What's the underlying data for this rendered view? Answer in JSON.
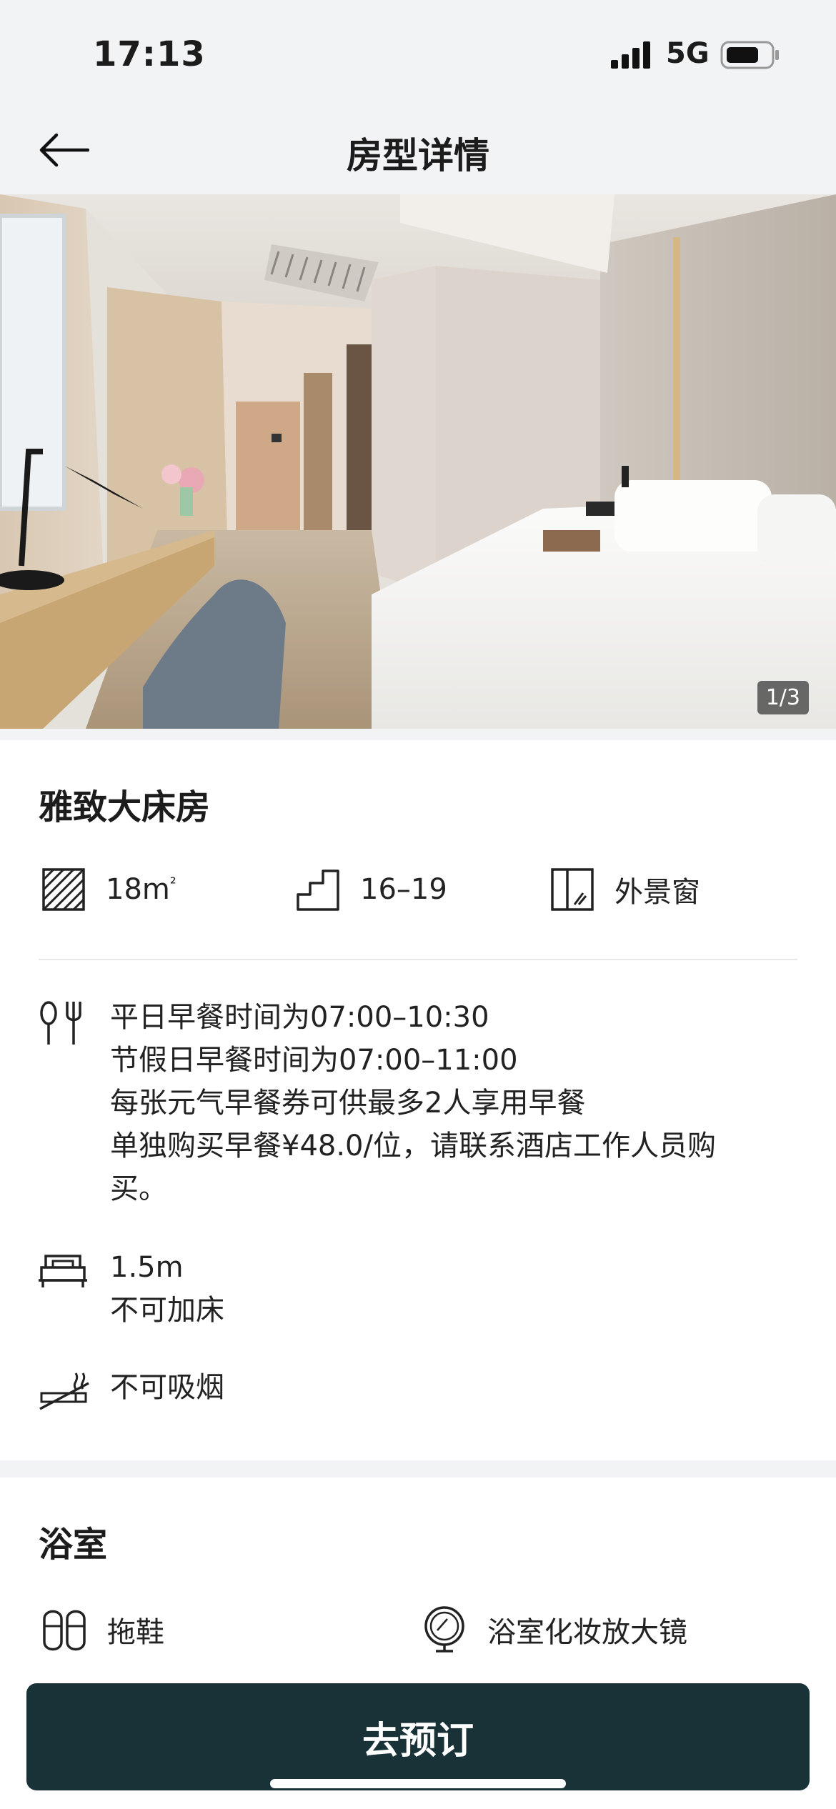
{
  "status_bar": {
    "time": "17:13",
    "network": "5G"
  },
  "nav": {
    "title": "房型详情",
    "back_icon": "arrow-left-icon"
  },
  "gallery": {
    "counter": "1/3"
  },
  "room": {
    "name": "雅致大床房",
    "area_base": "18m",
    "area_sup": "²",
    "floor": "16–19",
    "window": "外景窗"
  },
  "breakfast": {
    "lines": [
      "平日早餐时间为07:00–10:30",
      "节假日早餐时间为07:00–11:00",
      "每张元气早餐券可供最多2人享用早餐",
      "单独购买早餐¥48.0/位，请联系酒店工作人员购",
      "买。"
    ]
  },
  "bed": {
    "size": "1.5m",
    "extra_bed": "不可加床"
  },
  "smoking": {
    "text": "不可吸烟"
  },
  "bathroom": {
    "title": "浴室",
    "items": [
      "拖鞋",
      "浴室化妆放大镜"
    ]
  },
  "footer": {
    "book_label": "去预订"
  },
  "colors": {
    "primary": "#193238",
    "band": "#f2f3f5"
  }
}
